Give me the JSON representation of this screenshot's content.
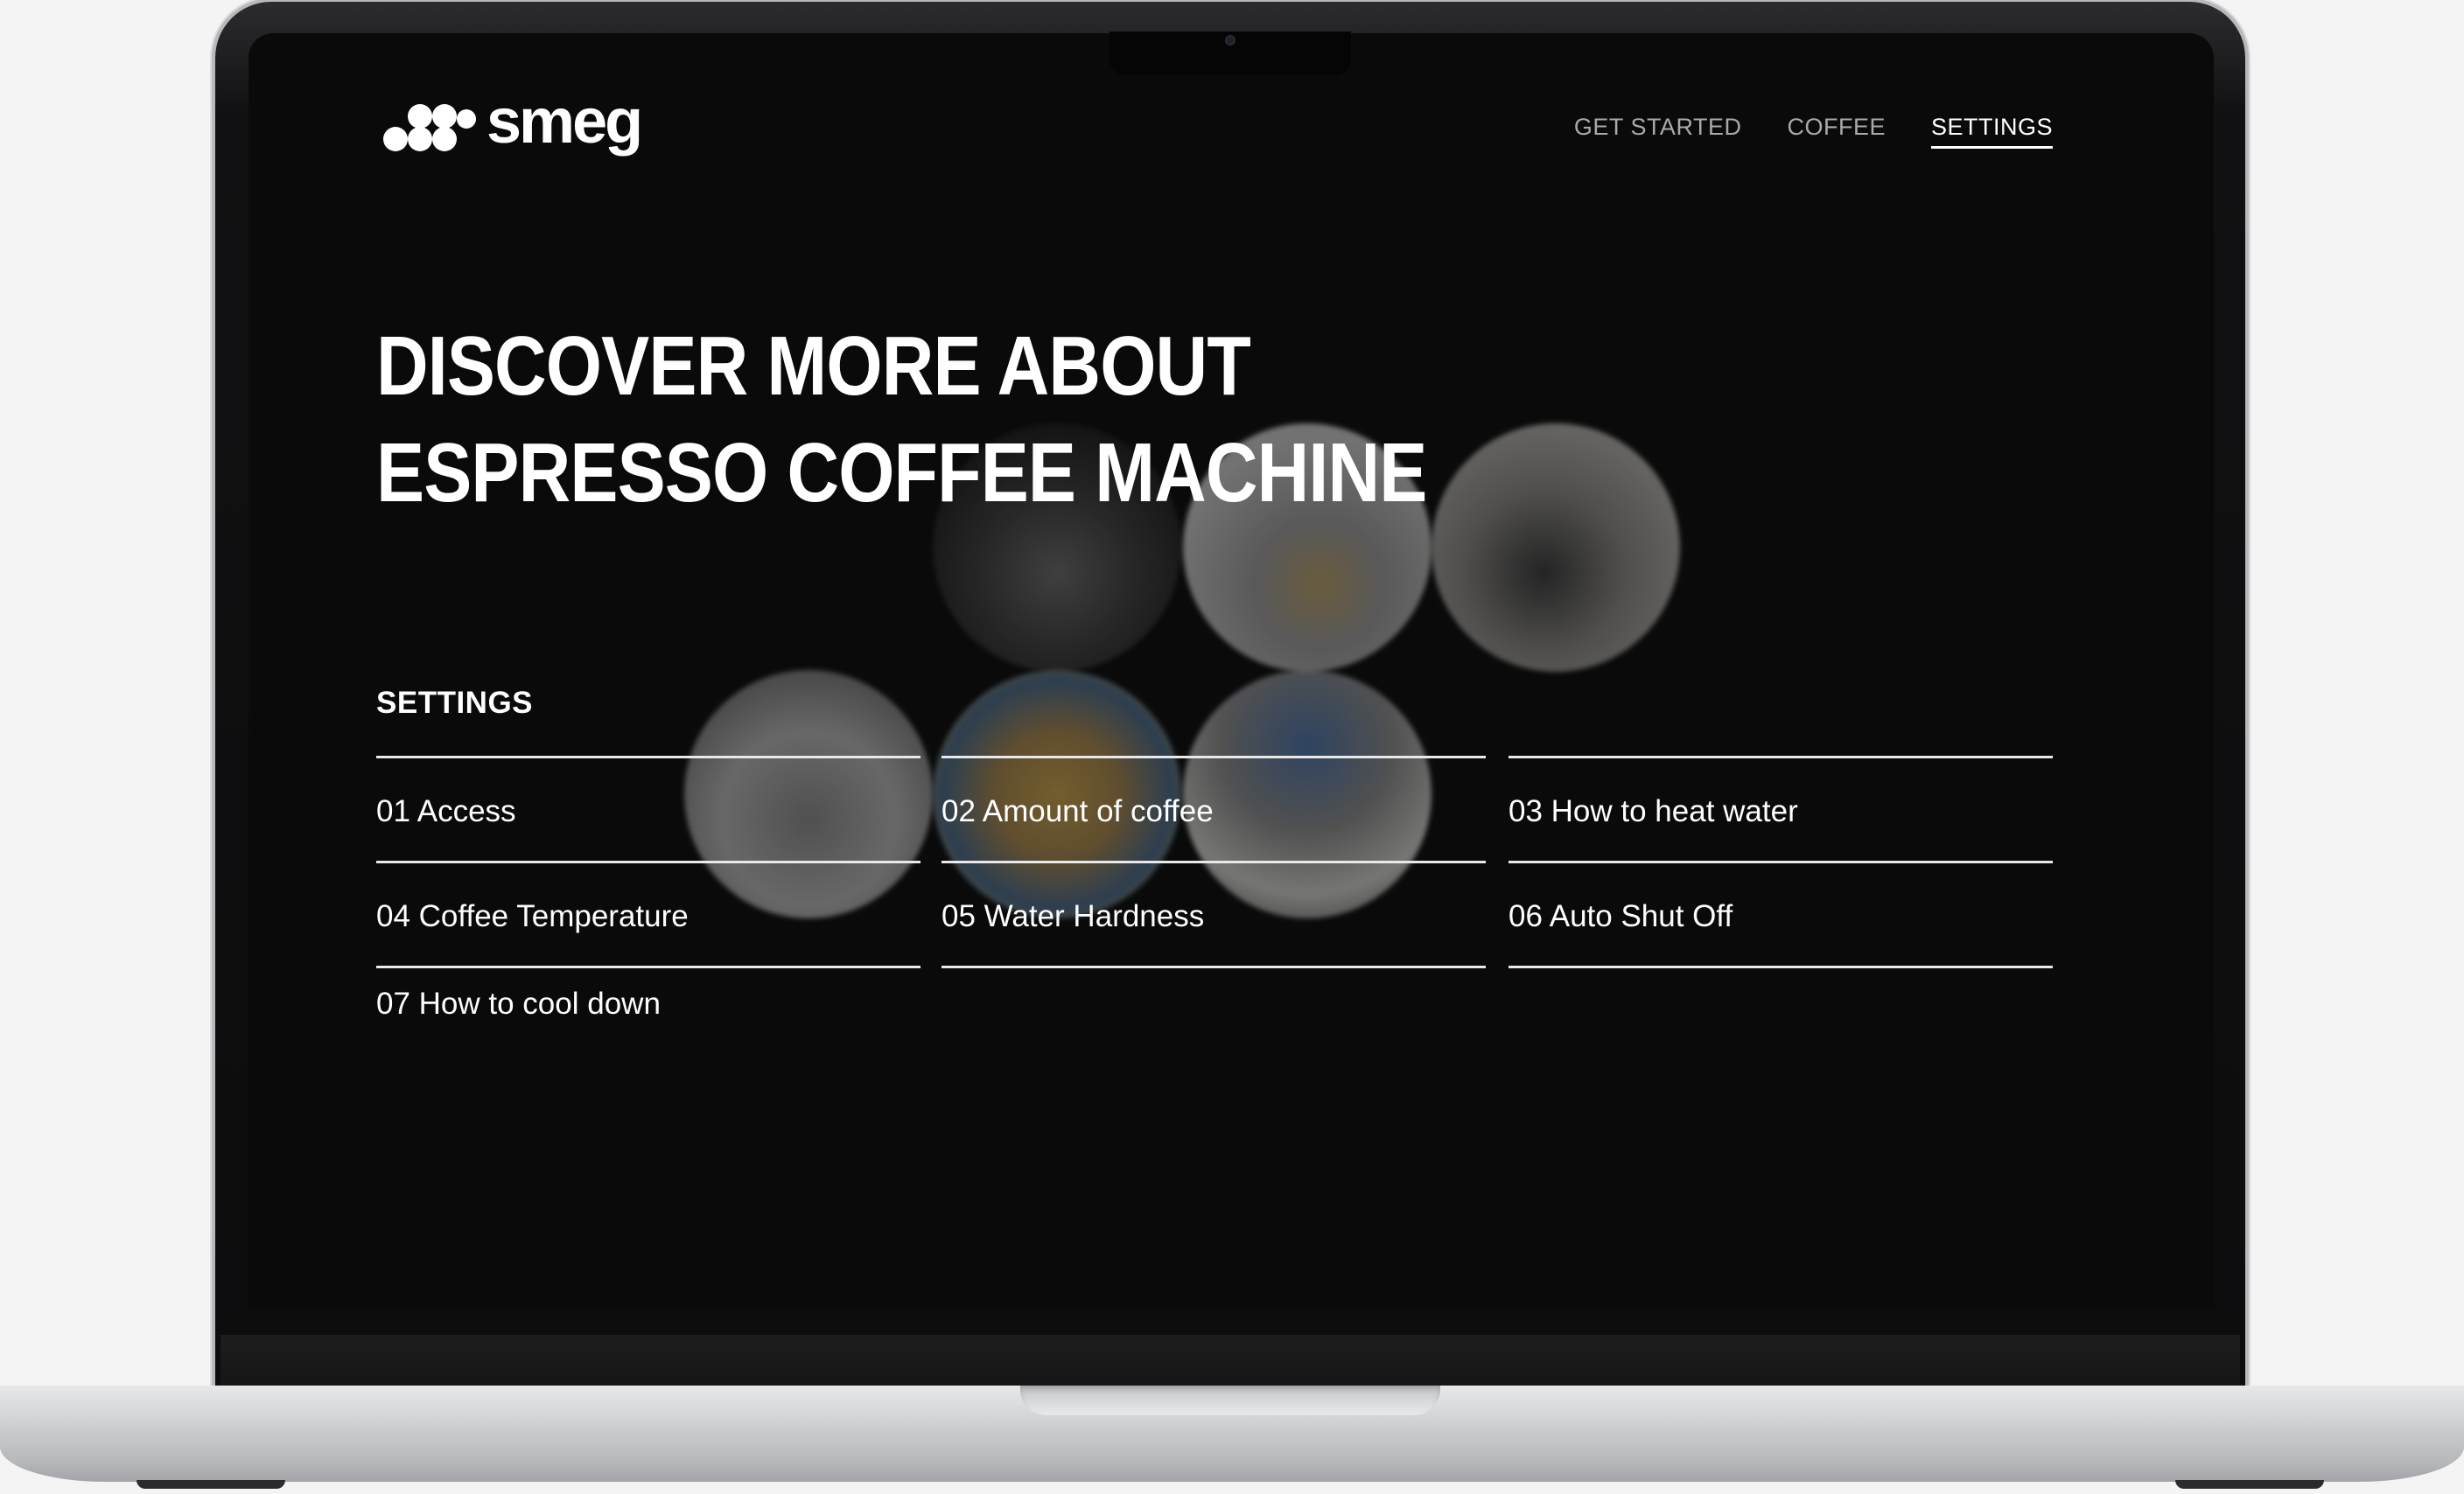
{
  "brand": {
    "logo_text": "smeg"
  },
  "nav": {
    "items": [
      {
        "label": "GET STARTED",
        "active": false
      },
      {
        "label": "COFFEE",
        "active": false
      },
      {
        "label": "SETTINGS",
        "active": true
      }
    ]
  },
  "hero": {
    "line1": "DISCOVER MORE ABOUT",
    "line2": "ESPRESSO COFFEE MACHINE"
  },
  "settings": {
    "heading": "SETTINGS",
    "items": [
      {
        "label": "01 Access"
      },
      {
        "label": "02 Amount of coffee"
      },
      {
        "label": "03 How to heat water"
      },
      {
        "label": "04 Coffee Temperature"
      },
      {
        "label": "05 Water Hardness"
      },
      {
        "label": "06 Auto Shut Off"
      },
      {
        "label": "07 How to cool down"
      }
    ]
  },
  "colors": {
    "screen_background": "#0a0a0a",
    "text": "#ffffff",
    "nav_inactive": "#a9a9a9",
    "divider": "#e9e9e9"
  }
}
